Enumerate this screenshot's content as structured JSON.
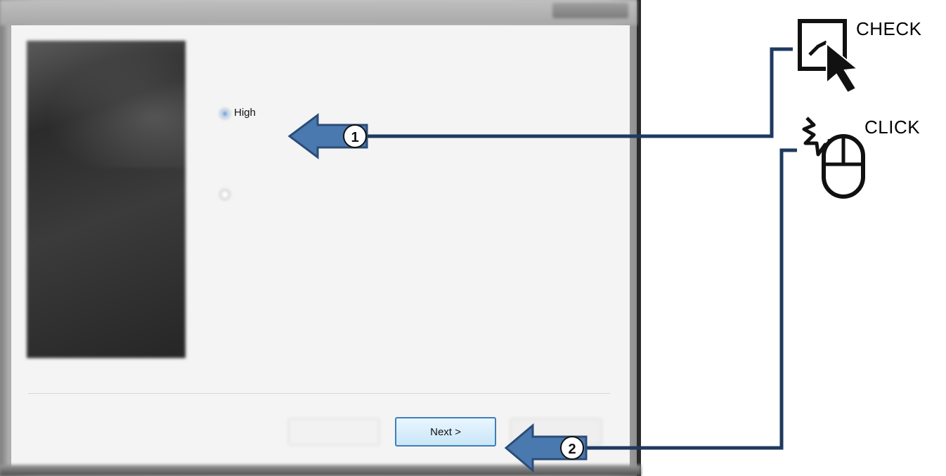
{
  "dialog": {
    "title": "",
    "instruction": "",
    "options": [
      {
        "label": "High",
        "description": "",
        "selected": true
      },
      {
        "label": "",
        "description": "",
        "selected": false
      }
    ],
    "buttons": {
      "back": "",
      "next": "Next >",
      "cancel": ""
    }
  },
  "annotations": {
    "check_label": "CHECK",
    "click_label": "CLICK",
    "step1": "1",
    "step2": "2",
    "arrow_color": "#4a79b0",
    "line_color": "#1f3a5f"
  }
}
